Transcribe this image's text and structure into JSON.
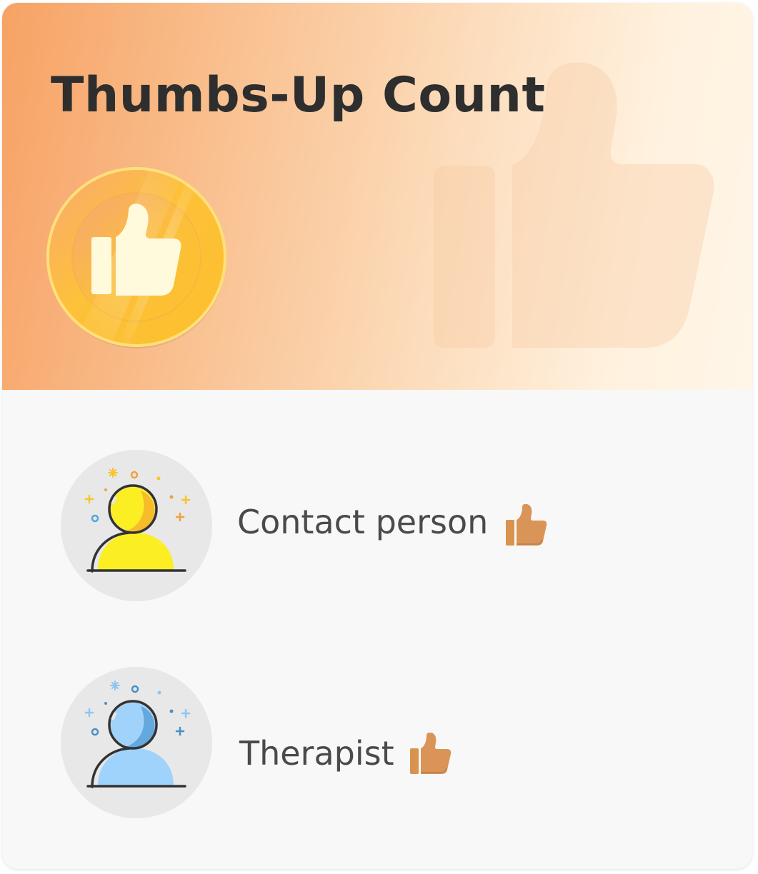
{
  "header": {
    "title": "Thumbs-Up Count"
  },
  "items": [
    {
      "label": "Contact person",
      "avatar_icon": "user-avatar-yellow-icon",
      "badge_icon": "thumbs-up-icon"
    },
    {
      "label": "Therapist",
      "avatar_icon": "user-avatar-blue-icon",
      "badge_icon": "thumbs-up-icon"
    }
  ],
  "colors": {
    "header_gradient_start": "#f7a264",
    "header_gradient_end": "#fff6e8",
    "title": "#2e2e2e",
    "label": "#4a4a4a",
    "thumb_accent": "#db9458",
    "medal_gold": "#fdbf2d",
    "avatar_yellow": "#fbef24",
    "avatar_blue": "#a0d3fb"
  }
}
